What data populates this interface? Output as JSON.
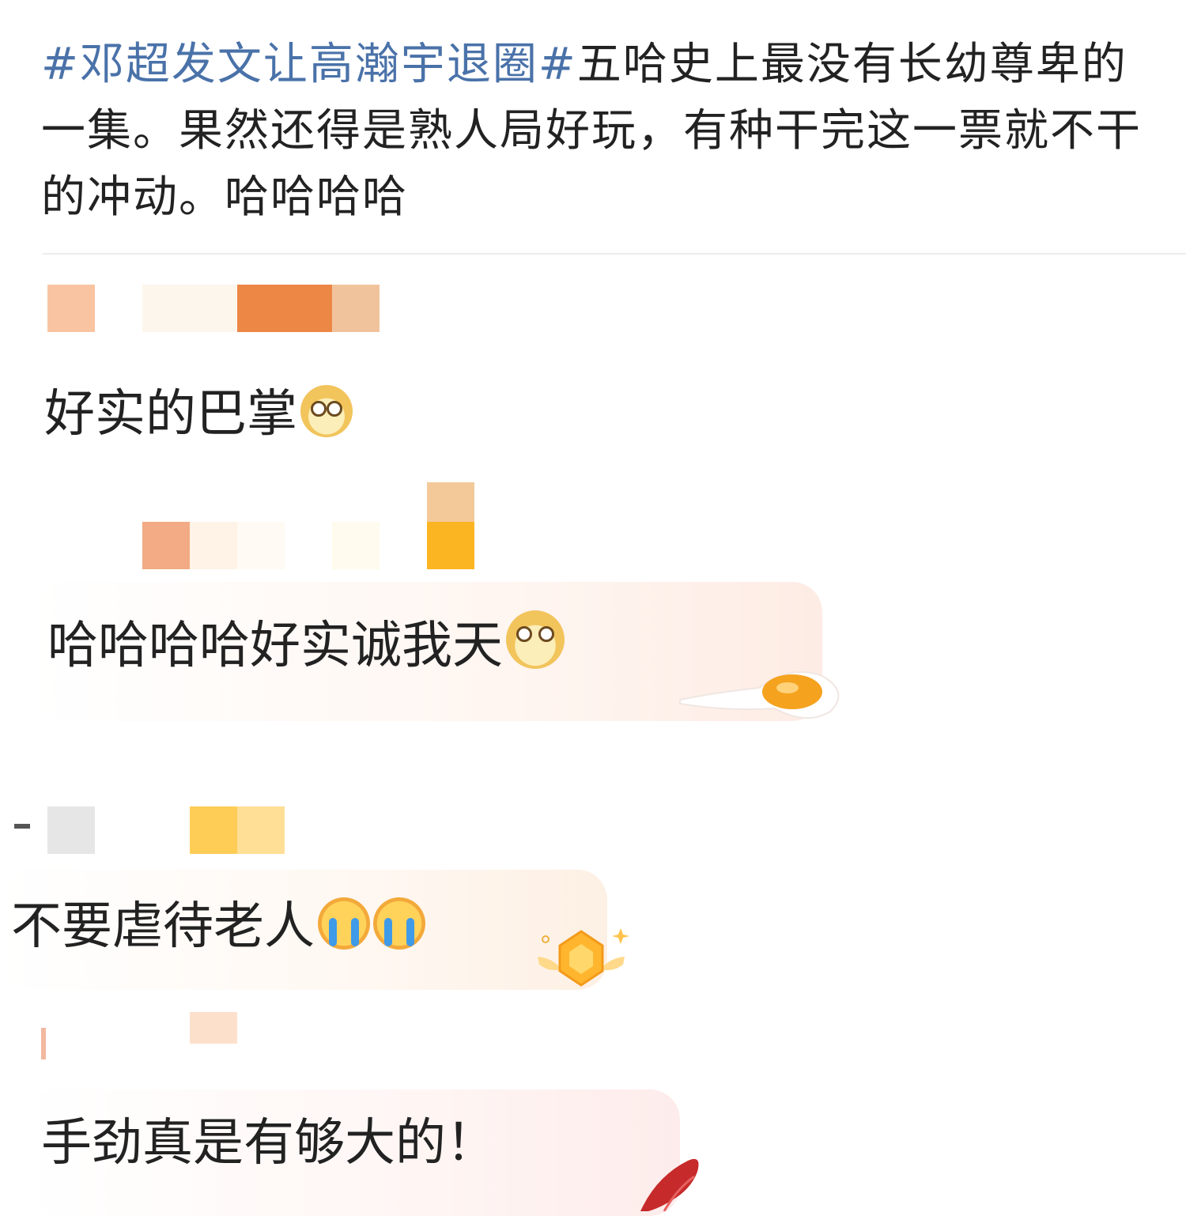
{
  "post": {
    "hashtag": "#邓超发文让高瀚宇退圈#",
    "body": "五哈史上最没有长幼尊卑的一集。果然还得是熟人局好玩，有种干完这一票就不干的冲动。哈哈哈哈"
  },
  "comments": [
    {
      "text": "好实的巴掌",
      "emojis": [
        "doge-emoji"
      ]
    },
    {
      "text": "哈哈哈哈好实诚我天",
      "emojis": [
        "doge-emoji"
      ]
    },
    {
      "text": "不要虐待老人",
      "emojis": [
        "crying-emoji",
        "crying-emoji"
      ]
    },
    {
      "text": "手劲真是有够大的！",
      "emojis": []
    }
  ],
  "colors": {
    "hashtag": "#4a72a9",
    "text": "#222222",
    "divider": "#ececec"
  }
}
